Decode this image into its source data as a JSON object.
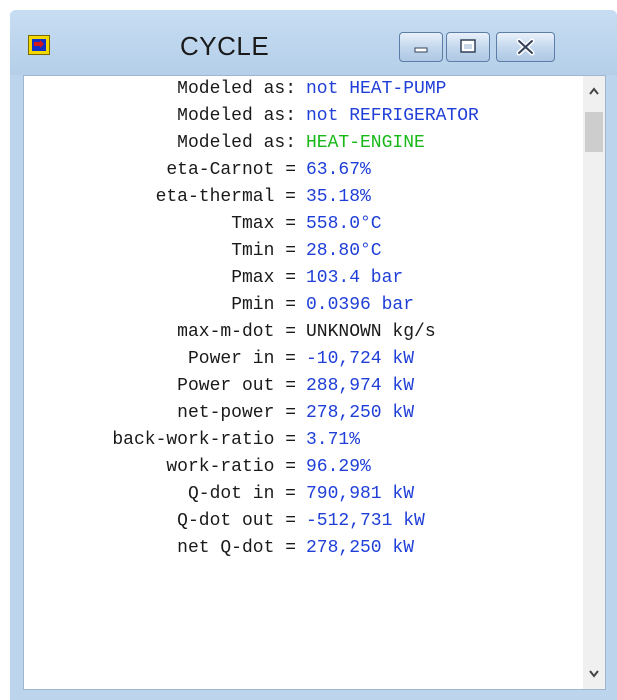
{
  "window": {
    "title": "CYCLE",
    "icon": "cycle-app-icon",
    "controls": [
      "minimize-icon",
      "maximize-icon",
      "close-icon"
    ]
  },
  "rows": [
    {
      "label": "Modeled as:",
      "value": "not HEAT-PUMP",
      "color": "#1f3fd8"
    },
    {
      "label": "Modeled as:",
      "value": "not REFRIGERATOR",
      "color": "#1f3fd8"
    },
    {
      "label": "Modeled as:",
      "value": "HEAT-ENGINE",
      "color": "#18b818"
    },
    {
      "label": "eta-Carnot =",
      "value": "63.67%",
      "color": "#1f3fd8"
    },
    {
      "label": "eta-thermal =",
      "value": "35.18%",
      "color": "#1f3fd8"
    },
    {
      "label": "Tmax =",
      "value": "558.0°C",
      "color": "#1f3fd8"
    },
    {
      "label": "Tmin =",
      "value": "28.80°C",
      "color": "#1f3fd8"
    },
    {
      "label": "Pmax =",
      "value": "103.4 bar",
      "color": "#1f3fd8"
    },
    {
      "label": "Pmin =",
      "value": "0.0396 bar",
      "color": "#1f3fd8"
    },
    {
      "label": "max-m-dot =",
      "value": "UNKNOWN kg/s",
      "color": "#1a1a1a"
    },
    {
      "label": "Power in =",
      "value": "-10,724 kW",
      "color": "#1f3fd8"
    },
    {
      "label": "Power out =",
      "value": "288,974 kW",
      "color": "#1f3fd8"
    },
    {
      "label": "net-power =",
      "value": "278,250 kW",
      "color": "#1f3fd8"
    },
    {
      "label": "back-work-ratio =",
      "value": "3.71%",
      "color": "#1f3fd8"
    },
    {
      "label": "work-ratio =",
      "value": "96.29%",
      "color": "#1f3fd8"
    },
    {
      "label": "Q-dot in =",
      "value": "790,981 kW",
      "color": "#1f3fd8"
    },
    {
      "label": "Q-dot out =",
      "value": "-512,731 kW",
      "color": "#1f3fd8"
    },
    {
      "label": "net Q-dot =",
      "value": "278,250 kW",
      "color": "#1f3fd8"
    }
  ],
  "scrollbar": {
    "up": "chevron-up-icon",
    "down": "chevron-down-icon"
  }
}
